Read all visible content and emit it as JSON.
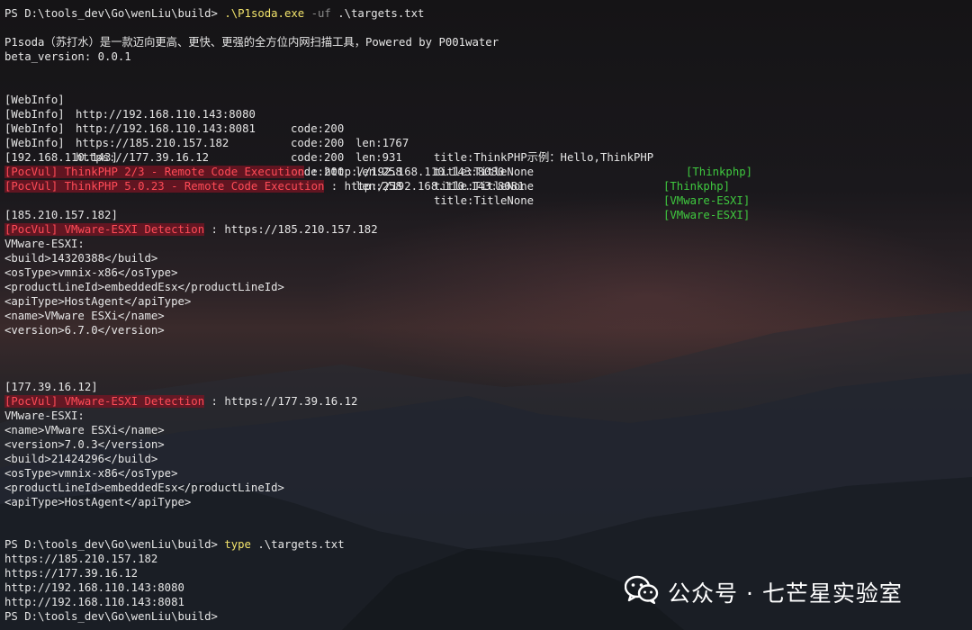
{
  "prompt1": "PS D:\\tools_dev\\Go\\wenLiu\\build>",
  "cmd1": {
    "exe": ".\\P1soda.exe",
    "flag": "-uf",
    "arg": ".\\targets.txt"
  },
  "banner": {
    "line1": "P1soda（苏打水）是一款迈向更高、更快、更强的全方位内网扫描工具，Powered by P001water",
    "line2": "beta_version: 0.0.1"
  },
  "webinfo": [
    {
      "tag": "[WebInfo]",
      "url": "http://192.168.110.143:8080",
      "code": "code:200",
      "len": "len:1767",
      "title": "title:ThinkPHP示例：Hello,ThinkPHP",
      "finger": "[Thinkphp]"
    },
    {
      "tag": "[WebInfo]",
      "url": "http://192.168.110.143:8081",
      "code": "code:200",
      "len": "len:931",
      "title": "title:TitleNone",
      "finger": "[Thinkphp]"
    },
    {
      "tag": "[WebInfo]",
      "url": "https://185.210.157.182",
      "code": "code:200",
      "len": "len:258",
      "title": "title:TitleNone",
      "finger": "[VMware-ESXI]"
    },
    {
      "tag": "[WebInfo]",
      "url": "https://177.39.16.12",
      "code": "code:200",
      "len": "len:258",
      "title": "title:TitleNone",
      "finger": "[VMware-ESXI]"
    }
  ],
  "hosts": [
    {
      "header": "[192.168.110.143]",
      "vulns": [
        {
          "tag": "[PocVul]",
          "name": "ThinkPHP 2/3 - Remote Code Execution",
          "target": " : http://192.168.110.143:8080"
        },
        {
          "tag": "[PocVul]",
          "name": "ThinkPHP 5.0.23 - Remote Code Execution",
          "target": " : http://192.168.110.143:8081"
        }
      ],
      "details": []
    },
    {
      "header": "[185.210.157.182]",
      "vulns": [
        {
          "tag": "[PocVul]",
          "name": "VMware-ESXI Detection",
          "target": " : https://185.210.157.182"
        }
      ],
      "details": [
        "VMware-ESXI:",
        "<build>14320388</build>",
        "<osType>vmnix-x86</osType>",
        "<productLineId>embeddedEsx</productLineId>",
        "<apiType>HostAgent</apiType>",
        "<name>VMware ESXi</name>",
        "<version>6.7.0</version>"
      ]
    },
    {
      "header": "[177.39.16.12]",
      "vulns": [
        {
          "tag": "[PocVul]",
          "name": "VMware-ESXI Detection",
          "target": " : https://177.39.16.12"
        }
      ],
      "details": [
        "VMware-ESXI:",
        "<name>VMware ESXi</name>",
        "<version>7.0.3</version>",
        "<build>21424296</build>",
        "<osType>vmnix-x86</osType>",
        "<productLineId>embeddedEsx</productLineId>",
        "<apiType>HostAgent</apiType>"
      ]
    }
  ],
  "prompt2": "PS D:\\tools_dev\\Go\\wenLiu\\build>",
  "cmd2": {
    "exe": "type",
    "arg": ".\\targets.txt"
  },
  "targets": [
    "https://185.210.157.182",
    "https://177.39.16.12",
    "http://192.168.110.143:8080",
    "http://192.168.110.143:8081"
  ],
  "prompt3": "PS D:\\tools_dev\\Go\\wenLiu\\build>",
  "watermark": {
    "text": "公众号 · 七芒星实验室",
    "icon": "wechat-icon"
  },
  "colors": {
    "command": "#f2e36b",
    "flag": "#8b8b8b",
    "finger": "#3fc93f",
    "pocvul": "#ff4b57"
  }
}
